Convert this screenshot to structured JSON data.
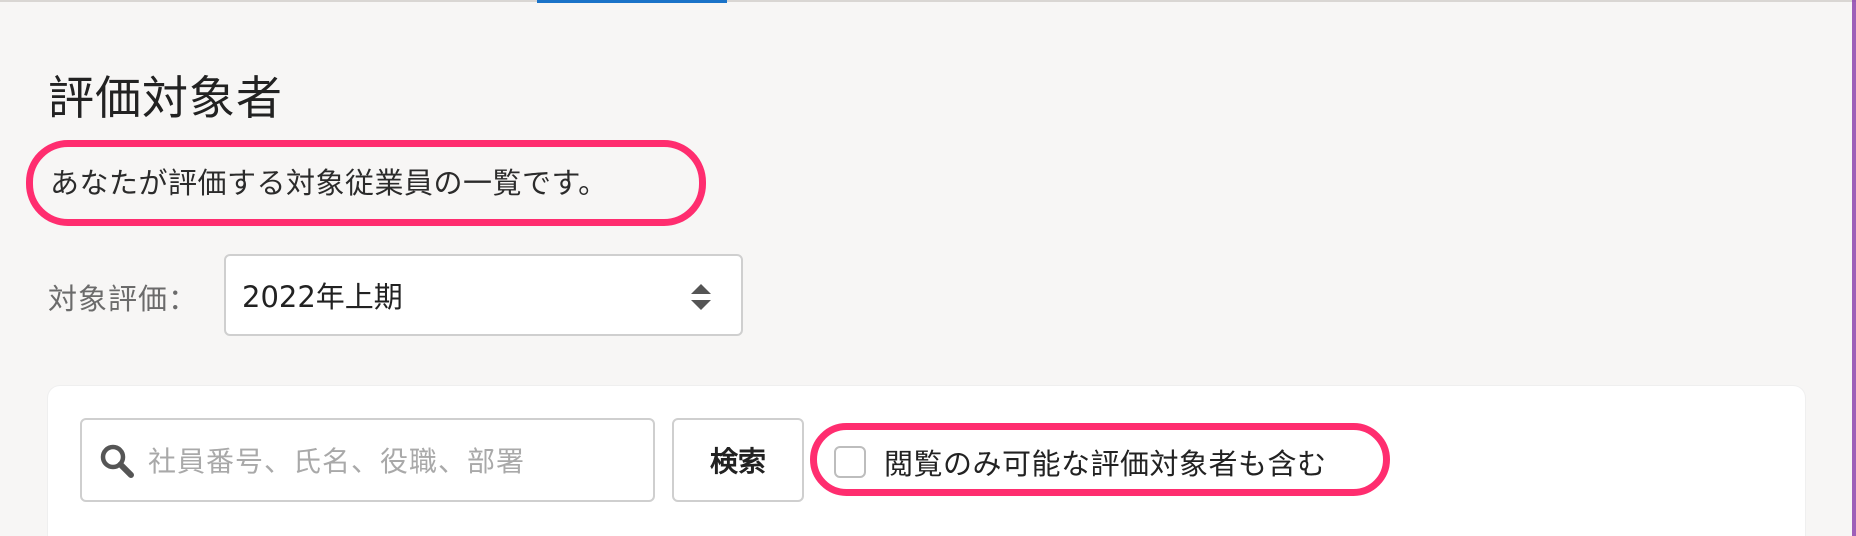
{
  "page": {
    "title": "評価対象者",
    "description": "あなたが評価する対象従業員の一覧です。"
  },
  "evaluation": {
    "label": "対象評価：",
    "selected": "2022年上期"
  },
  "search": {
    "placeholder": "社員番号、氏名、役職、部署",
    "value": "",
    "button_label": "検索"
  },
  "filter": {
    "checkbox_label": "閲覧のみ可能な評価対象者も含む",
    "checked": false
  },
  "colors": {
    "highlight": "#ff2d6f",
    "tab_indicator": "#1a73c8",
    "background": "#f7f6f5"
  },
  "icons": {
    "search": "search-icon",
    "select": "select-arrows-icon"
  }
}
